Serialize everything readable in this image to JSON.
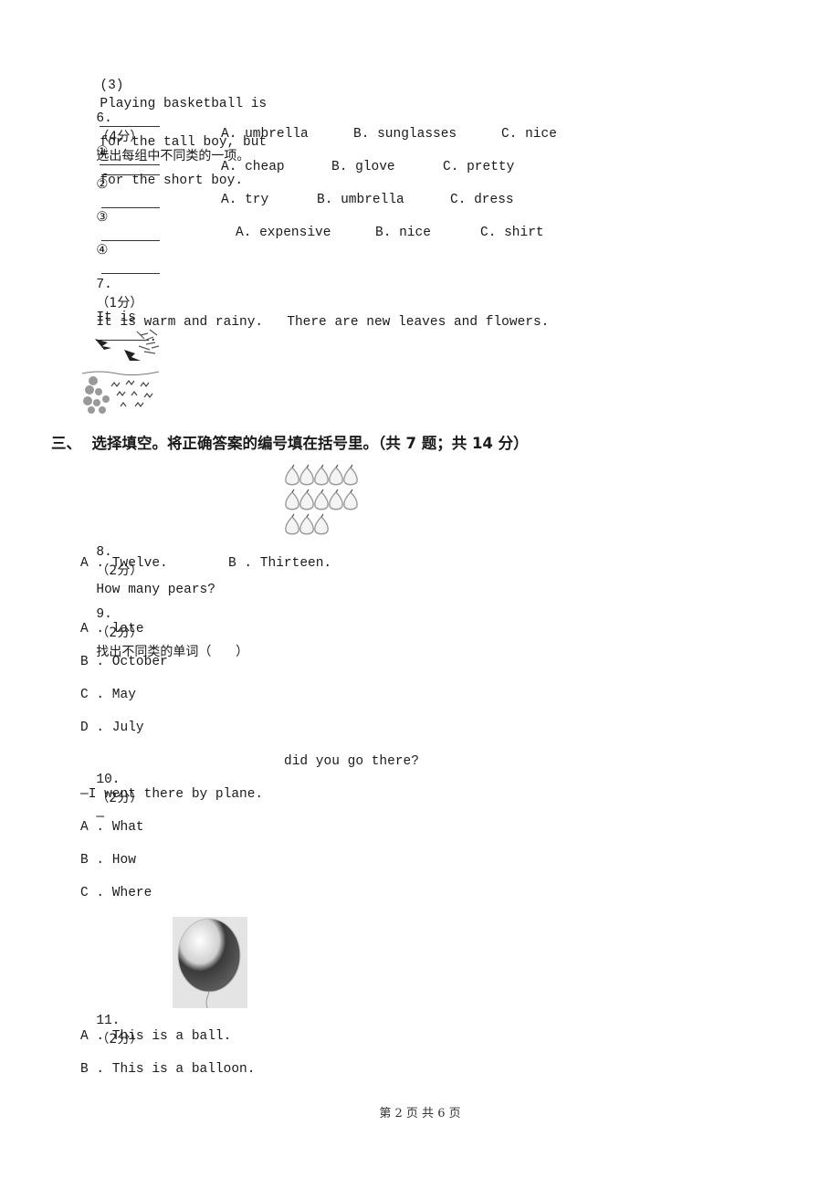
{
  "q5_item3": {
    "label": "(3)",
    "text1": "Playing basketball is",
    "text2": "for the tall boy, but",
    "text3": "for the short boy."
  },
  "q6": {
    "number": "6.",
    "score": "（4分）",
    "prompt": "选出每组中不同类的一项。",
    "groups": [
      {
        "marker": "①",
        "a": "A. umbrella",
        "b": "B. sunglasses",
        "c": "C. nice"
      },
      {
        "marker": "②",
        "a": "A. cheap",
        "b": "B. glove",
        "c": "C. pretty"
      },
      {
        "marker": "③",
        "a": "A. try",
        "b": "B. umbrella",
        "c": "C. dress"
      },
      {
        "marker": "④",
        "a": "A. expensive",
        "b": "B. nice",
        "c": "C. shirt"
      }
    ]
  },
  "q7": {
    "number": "7.",
    "score": "（1分）",
    "text": "It is warm and rainy.   There are new leaves and flowers.",
    "answer_prefix": "It is",
    "answer_suffix": ".",
    "image": "spring-birds-flowers-illustration"
  },
  "section3": {
    "title": "三、  选择填空。将正确答案的编号填在括号里。（共 7 题；共 14 分）"
  },
  "q8": {
    "number": "8.",
    "score": "（2分）",
    "text": "How many pears?",
    "image": "pears-illustration",
    "options": [
      "A . Twelve.",
      "B . Thirteen."
    ]
  },
  "q9": {
    "number": "9.",
    "score": "（2分）",
    "text": "找出不同类的单词（      ）",
    "options": [
      "A . late",
      "B . October",
      "C . May",
      "D . July"
    ]
  },
  "q10": {
    "number": "10.",
    "score": "（2分）",
    "text_prefix": "—",
    "text_suffix": "did you go there?",
    "answer_line": "—I went there by plane.",
    "options": [
      "A . What",
      "B . How",
      "C . Where"
    ]
  },
  "q11": {
    "number": "11.",
    "score": "（2分）",
    "image": "balloon-photo",
    "options": [
      "A . This is a ball.",
      "B . This is a balloon."
    ]
  },
  "footer": {
    "page_text": "第 2 页 共 6 页"
  }
}
